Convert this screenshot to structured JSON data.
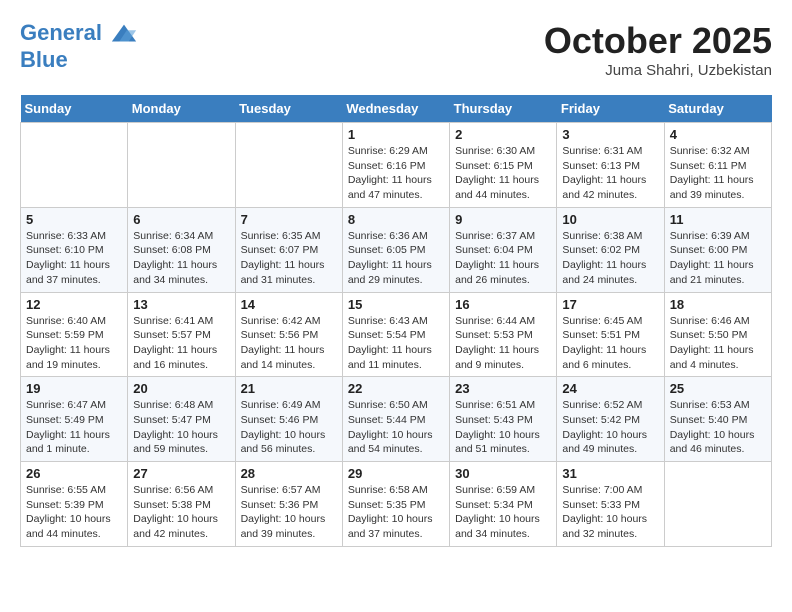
{
  "header": {
    "logo_line1": "General",
    "logo_line2": "Blue",
    "month": "October 2025",
    "location": "Juma Shahri, Uzbekistan"
  },
  "weekdays": [
    "Sunday",
    "Monday",
    "Tuesday",
    "Wednesday",
    "Thursday",
    "Friday",
    "Saturday"
  ],
  "weeks": [
    [
      {
        "day": "",
        "info": ""
      },
      {
        "day": "",
        "info": ""
      },
      {
        "day": "",
        "info": ""
      },
      {
        "day": "1",
        "info": "Sunrise: 6:29 AM\nSunset: 6:16 PM\nDaylight: 11 hours and 47 minutes."
      },
      {
        "day": "2",
        "info": "Sunrise: 6:30 AM\nSunset: 6:15 PM\nDaylight: 11 hours and 44 minutes."
      },
      {
        "day": "3",
        "info": "Sunrise: 6:31 AM\nSunset: 6:13 PM\nDaylight: 11 hours and 42 minutes."
      },
      {
        "day": "4",
        "info": "Sunrise: 6:32 AM\nSunset: 6:11 PM\nDaylight: 11 hours and 39 minutes."
      }
    ],
    [
      {
        "day": "5",
        "info": "Sunrise: 6:33 AM\nSunset: 6:10 PM\nDaylight: 11 hours and 37 minutes."
      },
      {
        "day": "6",
        "info": "Sunrise: 6:34 AM\nSunset: 6:08 PM\nDaylight: 11 hours and 34 minutes."
      },
      {
        "day": "7",
        "info": "Sunrise: 6:35 AM\nSunset: 6:07 PM\nDaylight: 11 hours and 31 minutes."
      },
      {
        "day": "8",
        "info": "Sunrise: 6:36 AM\nSunset: 6:05 PM\nDaylight: 11 hours and 29 minutes."
      },
      {
        "day": "9",
        "info": "Sunrise: 6:37 AM\nSunset: 6:04 PM\nDaylight: 11 hours and 26 minutes."
      },
      {
        "day": "10",
        "info": "Sunrise: 6:38 AM\nSunset: 6:02 PM\nDaylight: 11 hours and 24 minutes."
      },
      {
        "day": "11",
        "info": "Sunrise: 6:39 AM\nSunset: 6:00 PM\nDaylight: 11 hours and 21 minutes."
      }
    ],
    [
      {
        "day": "12",
        "info": "Sunrise: 6:40 AM\nSunset: 5:59 PM\nDaylight: 11 hours and 19 minutes."
      },
      {
        "day": "13",
        "info": "Sunrise: 6:41 AM\nSunset: 5:57 PM\nDaylight: 11 hours and 16 minutes."
      },
      {
        "day": "14",
        "info": "Sunrise: 6:42 AM\nSunset: 5:56 PM\nDaylight: 11 hours and 14 minutes."
      },
      {
        "day": "15",
        "info": "Sunrise: 6:43 AM\nSunset: 5:54 PM\nDaylight: 11 hours and 11 minutes."
      },
      {
        "day": "16",
        "info": "Sunrise: 6:44 AM\nSunset: 5:53 PM\nDaylight: 11 hours and 9 minutes."
      },
      {
        "day": "17",
        "info": "Sunrise: 6:45 AM\nSunset: 5:51 PM\nDaylight: 11 hours and 6 minutes."
      },
      {
        "day": "18",
        "info": "Sunrise: 6:46 AM\nSunset: 5:50 PM\nDaylight: 11 hours and 4 minutes."
      }
    ],
    [
      {
        "day": "19",
        "info": "Sunrise: 6:47 AM\nSunset: 5:49 PM\nDaylight: 11 hours and 1 minute."
      },
      {
        "day": "20",
        "info": "Sunrise: 6:48 AM\nSunset: 5:47 PM\nDaylight: 10 hours and 59 minutes."
      },
      {
        "day": "21",
        "info": "Sunrise: 6:49 AM\nSunset: 5:46 PM\nDaylight: 10 hours and 56 minutes."
      },
      {
        "day": "22",
        "info": "Sunrise: 6:50 AM\nSunset: 5:44 PM\nDaylight: 10 hours and 54 minutes."
      },
      {
        "day": "23",
        "info": "Sunrise: 6:51 AM\nSunset: 5:43 PM\nDaylight: 10 hours and 51 minutes."
      },
      {
        "day": "24",
        "info": "Sunrise: 6:52 AM\nSunset: 5:42 PM\nDaylight: 10 hours and 49 minutes."
      },
      {
        "day": "25",
        "info": "Sunrise: 6:53 AM\nSunset: 5:40 PM\nDaylight: 10 hours and 46 minutes."
      }
    ],
    [
      {
        "day": "26",
        "info": "Sunrise: 6:55 AM\nSunset: 5:39 PM\nDaylight: 10 hours and 44 minutes."
      },
      {
        "day": "27",
        "info": "Sunrise: 6:56 AM\nSunset: 5:38 PM\nDaylight: 10 hours and 42 minutes."
      },
      {
        "day": "28",
        "info": "Sunrise: 6:57 AM\nSunset: 5:36 PM\nDaylight: 10 hours and 39 minutes."
      },
      {
        "day": "29",
        "info": "Sunrise: 6:58 AM\nSunset: 5:35 PM\nDaylight: 10 hours and 37 minutes."
      },
      {
        "day": "30",
        "info": "Sunrise: 6:59 AM\nSunset: 5:34 PM\nDaylight: 10 hours and 34 minutes."
      },
      {
        "day": "31",
        "info": "Sunrise: 7:00 AM\nSunset: 5:33 PM\nDaylight: 10 hours and 32 minutes."
      },
      {
        "day": "",
        "info": ""
      }
    ]
  ]
}
